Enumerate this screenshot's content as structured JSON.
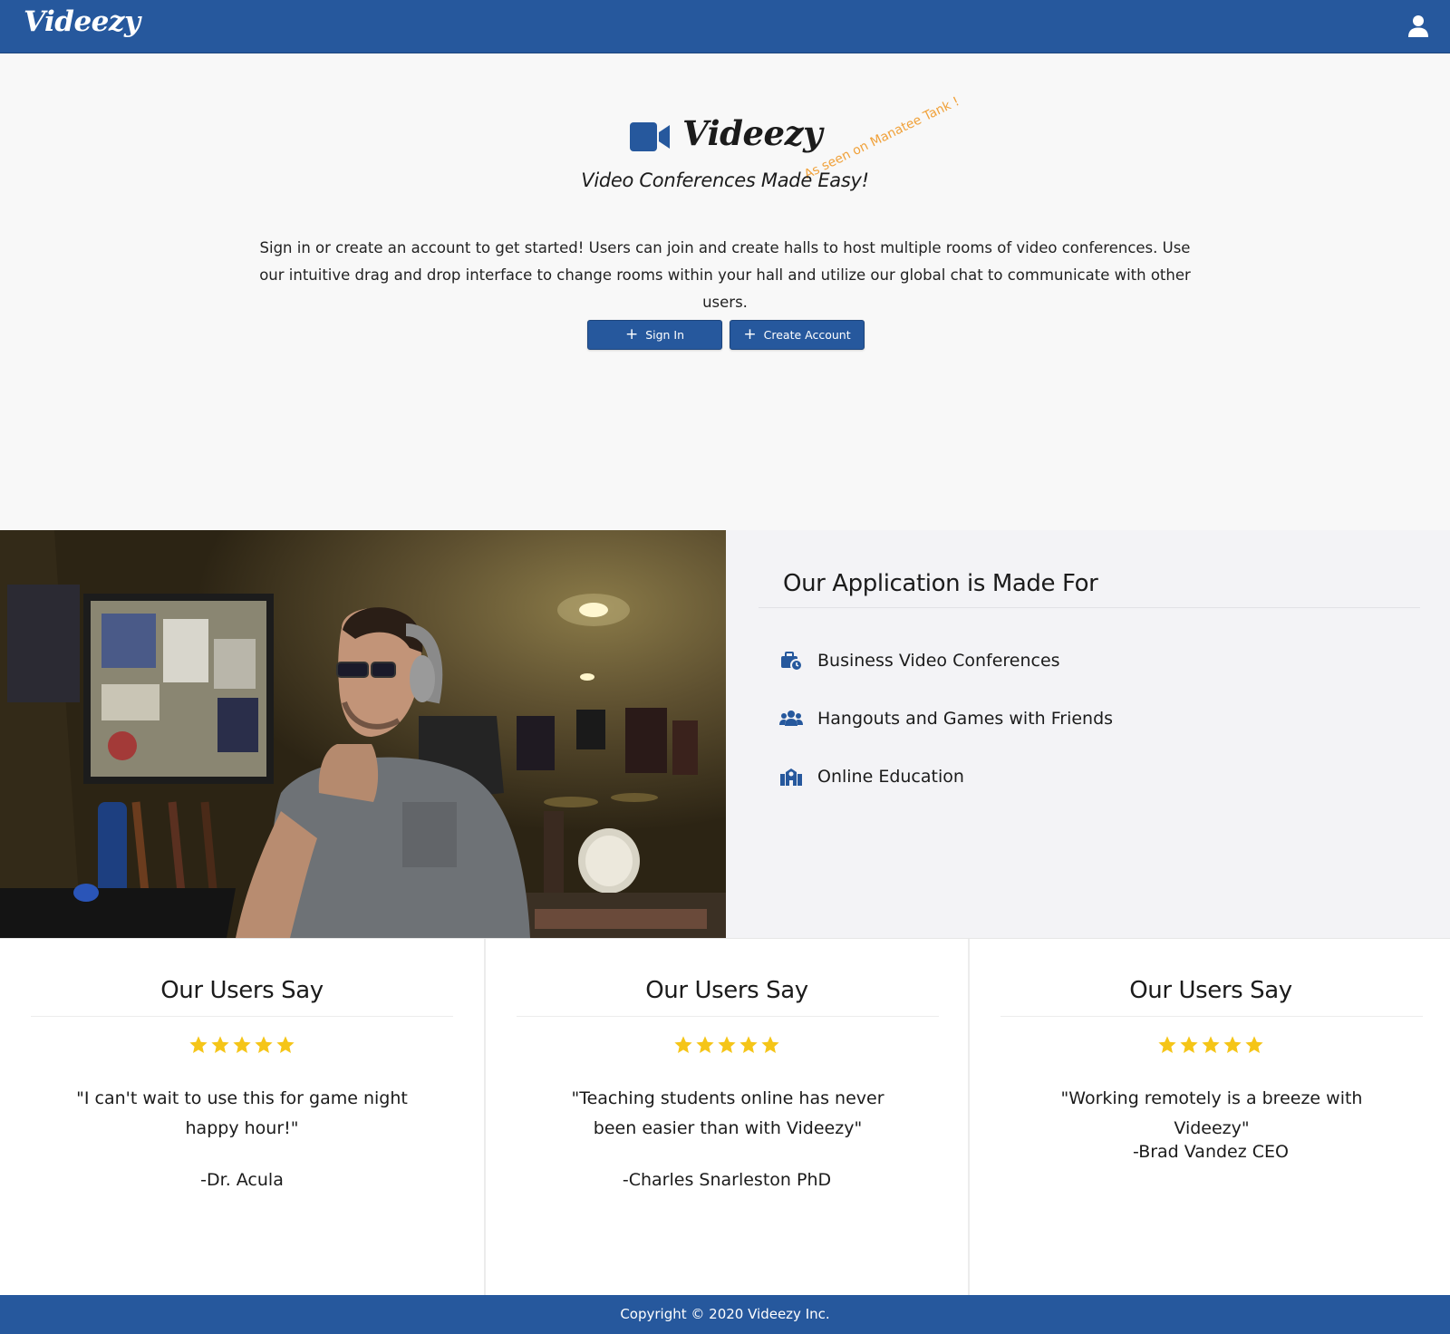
{
  "navbar": {
    "brand": "Videezy",
    "user_icon": "user-icon"
  },
  "hero": {
    "logo_text": "Videezy",
    "badge": "As seen on Manatee Tank !",
    "tagline": "Video Conferences Made Easy!",
    "intro": "Sign in or create an account to get started! Users can join and create halls to host multiple rooms of video conferences. Use our intuitive drag and drop interface to change rooms within your hall and utilize our global chat to communicate with other users.",
    "buttons": {
      "sign_in": "Sign In",
      "create_account": "Create Account"
    }
  },
  "made_for": {
    "title": "Our Application is Made For",
    "items": [
      {
        "label": "Business Video Conferences",
        "icon": "business-time-icon"
      },
      {
        "label": "Hangouts and Games with Friends",
        "icon": "users-icon"
      },
      {
        "label": "Online Education",
        "icon": "school-icon"
      }
    ]
  },
  "testimonials": [
    {
      "title": "Our Users Say",
      "rating": 5,
      "quote": "\"I can't wait to use this for game night happy hour!\"",
      "author": "-Dr. Acula"
    },
    {
      "title": "Our Users Say",
      "rating": 5,
      "quote": "\"Teaching students online has never been easier than with Videezy\"",
      "author": "-Charles Snarleston PhD"
    },
    {
      "title": "Our Users Say",
      "rating": 5,
      "quote": "\"Working remotely is a breeze with Videezy\"",
      "author": "-Brad Vandez CEO"
    }
  ],
  "footer": {
    "text": "Copyright © 2020 Videezy Inc."
  },
  "colors": {
    "primary": "#26589d",
    "badge": "#f0a13a",
    "star": "#f5c518",
    "panel": "#f3f3f6"
  }
}
